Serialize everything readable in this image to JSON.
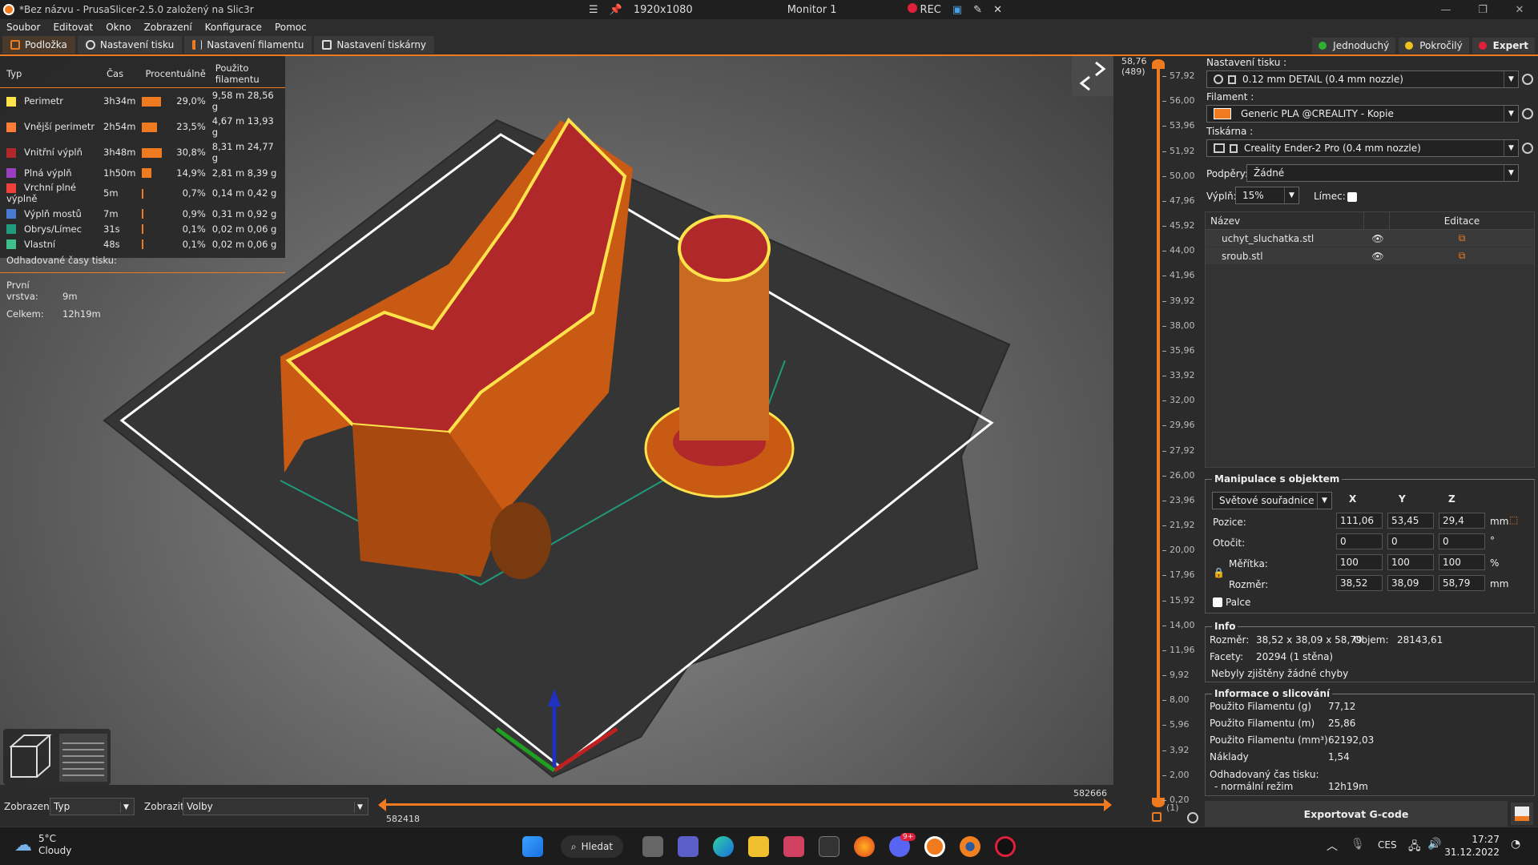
{
  "window": {
    "title": "*Bez názvu - PrusaSlicer-2.5.0 založený na Slic3r",
    "resolution": "1920x1080",
    "monitor": "Monitor 1",
    "rec_label": "REC"
  },
  "menu": [
    "Soubor",
    "Editovat",
    "Okno",
    "Zobrazení",
    "Konfigurace",
    "Pomoc"
  ],
  "tabs": [
    "Podložka",
    "Nastavení tisku",
    "Nastavení filamentu",
    "Nastavení tiskárny"
  ],
  "modes": [
    {
      "label": "Jednoduchý",
      "color": "#2fb02f"
    },
    {
      "label": "Pokročilý",
      "color": "#f0c020"
    },
    {
      "label": "Expert",
      "color": "#e0203a"
    }
  ],
  "legend": {
    "headers": [
      "Typ",
      "Čas",
      "Procentuálně",
      "Použito filamentu"
    ],
    "rows": [
      {
        "type": "Perimetr",
        "color": "#ffe34a",
        "time": "3h34m",
        "pct": "29,0%",
        "pct_value": 29.0,
        "len": "9,58 m",
        "weight": "28,56 g"
      },
      {
        "type": "Vnější perimetr",
        "color": "#ff7d38",
        "time": "2h54m",
        "pct": "23,5%",
        "pct_value": 23.5,
        "len": "4,67 m",
        "weight": "13,93 g"
      },
      {
        "type": "Vnitřní výplň",
        "color": "#b0282a",
        "time": "3h48m",
        "pct": "30,8%",
        "pct_value": 30.8,
        "len": "8,31 m",
        "weight": "24,77 g"
      },
      {
        "type": "Plná výplň",
        "color": "#9a3fc0",
        "time": "1h50m",
        "pct": "14,9%",
        "pct_value": 14.9,
        "len": "2,81 m",
        "weight": "8,39 g"
      },
      {
        "type": "Vrchní plné výplně",
        "color": "#f0403a",
        "time": "5m",
        "pct": "0,7%",
        "pct_value": 0.7,
        "len": "0,14 m",
        "weight": "0,42 g"
      },
      {
        "type": "Výplň mostů",
        "color": "#4a7bd0",
        "time": "7m",
        "pct": "0,9%",
        "pct_value": 0.9,
        "len": "0,31 m",
        "weight": "0,92 g"
      },
      {
        "type": "Obrys/Límec",
        "color": "#1f9a7a",
        "time": "31s",
        "pct": "0,1%",
        "pct_value": 0.1,
        "len": "0,02 m",
        "weight": "0,06 g"
      },
      {
        "type": "Vlastní",
        "color": "#3fc08a",
        "time": "48s",
        "pct": "0,1%",
        "pct_value": 0.1,
        "len": "0,02 m",
        "weight": "0,06 g"
      }
    ],
    "estimated_label": "Odhadované časy tisku:",
    "first_layer_label": "První vrstva:",
    "first_layer": "9m",
    "total_label": "Celkem:",
    "total": "12h19m"
  },
  "vslider": {
    "top_value": "58,76",
    "top_layer": "(489)",
    "ticks": [
      "57,92",
      "56,00",
      "53,96",
      "51,92",
      "50,00",
      "47,96",
      "45,92",
      "44,00",
      "41,96",
      "39,92",
      "38,00",
      "35,96",
      "33,92",
      "32,00",
      "29,96",
      "27,92",
      "26,00",
      "23,96",
      "21,92",
      "20,00",
      "17,96",
      "15,92",
      "14,00",
      "11,96",
      "9,92",
      "8,00",
      "5,96",
      "3,92",
      "2,00",
      "0,20"
    ],
    "bottom_layer": "(1)"
  },
  "hslider": {
    "left_value": "582418",
    "right_value": "582666"
  },
  "bottom": {
    "view_label": "Zobrazení",
    "view_value": "Typ",
    "show_label": "Zobrazit",
    "show_value": "Volby"
  },
  "print_settings": {
    "label": "Nastavení tisku :",
    "value": "0.12 mm DETAIL (0.4 mm nozzle)"
  },
  "filament": {
    "label": "Filament :",
    "value": "Generic PLA @CREALITY - Kopie",
    "color": "#f07a20"
  },
  "printer": {
    "label": "Tiskárna :",
    "value": "Creality Ender-2 Pro (0.4 mm nozzle)"
  },
  "supports": {
    "label": "Podpěry:",
    "value": "Žádné"
  },
  "infill": {
    "label": "Výplň:",
    "value": "15%"
  },
  "brim": {
    "label": "Límec:"
  },
  "object_list": {
    "headers": [
      "Název",
      "Editace"
    ],
    "items": [
      "uchyt_sluchatka.stl",
      "sroub.stl"
    ]
  },
  "manipulation": {
    "title": "Manipulace s objektem",
    "coord_system": "Světové souřadnice",
    "axes": [
      "X",
      "Y",
      "Z"
    ],
    "position": {
      "label": "Pozice:",
      "values": [
        "111,06",
        "53,45",
        "29,4"
      ],
      "unit": "mm"
    },
    "rotation": {
      "label": "Otočit:",
      "values": [
        "0",
        "0",
        "0"
      ],
      "unit": "°"
    },
    "scale": {
      "label": "Měřítka:",
      "values": [
        "100",
        "100",
        "100"
      ],
      "unit": "%"
    },
    "size": {
      "label": "Rozměr:",
      "values": [
        "38,52",
        "38,09",
        "58,79"
      ],
      "unit": "mm"
    },
    "inches_label": "Palce"
  },
  "info": {
    "title": "Info",
    "size_label": "Rozměr:",
    "size": "38,52 x 38,09 x 58,79",
    "volume_label": "Objem:",
    "volume": "28143,61",
    "facets_label": "Facety:",
    "facets": "20294 (1 stěna)",
    "errors": "Nebyly zjištěny žádné chyby"
  },
  "slice_info": {
    "title": "Informace o slicování",
    "rows": [
      {
        "label": "Použito Filamentu (g)",
        "value": "77,12"
      },
      {
        "label": "Použito Filamentu (m)",
        "value": "25,86"
      },
      {
        "label": "Použito Filamentu (mm³)",
        "value": "62192,03"
      },
      {
        "label": "Náklady",
        "value": "1,54"
      }
    ],
    "est_label": "Odhadovaný čas tisku:",
    "mode_label": "- normální režim",
    "mode_value": "12h19m"
  },
  "export_label": "Exportovat G-code",
  "taskbar": {
    "weather_temp": "5°C",
    "weather_desc": "Cloudy",
    "search_label": "Hledat",
    "lang": "CES",
    "time": "17:27",
    "date": "31.12.2022",
    "badge": "9+"
  }
}
